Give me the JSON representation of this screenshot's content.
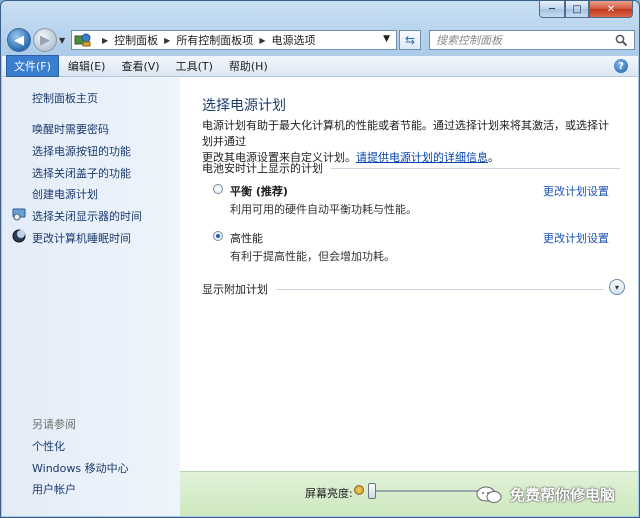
{
  "window": {
    "min_symbol": "─",
    "max_symbol": "□",
    "close_symbol": "✕"
  },
  "address": {
    "crumbs": [
      "控制面板",
      "所有控制面板项",
      "电源选项"
    ],
    "search_placeholder": "搜索控制面板"
  },
  "menu": {
    "items": [
      "文件(F)",
      "编辑(E)",
      "查看(V)",
      "工具(T)",
      "帮助(H)"
    ]
  },
  "sidebar": {
    "home": "控制面板主页",
    "links": [
      "唤醒时需要密码",
      "选择电源按钮的功能",
      "选择关闭盖子的功能",
      "创建电源计划",
      "选择关闭显示器的时间",
      "更改计算机睡眠时间"
    ],
    "see_also_title": "另请参阅",
    "see_also": [
      "个性化",
      "Windows 移动中心",
      "用户帐户"
    ]
  },
  "main": {
    "title": "选择电源计划",
    "desc_line1": "电源计划有助于最大化计算机的性能或者节能。通过选择计划来将其激活，或选择计划并通过",
    "desc_line2_prefix": "更改其电源设置来自定义计划。",
    "desc_link": "请提供电源计划的详细信息",
    "desc_end": "。",
    "group_label": "电池安时计上显示的计划",
    "plans": [
      {
        "name": "平衡 (推荐)",
        "desc": "利用可用的硬件自动平衡功耗与性能。",
        "change": "更改计划设置",
        "selected": false
      },
      {
        "name": "高性能",
        "desc": "有利于提高性能，但会增加功耗。",
        "change": "更改计划设置",
        "selected": true
      }
    ],
    "more_plans": "显示附加计划",
    "expander_symbol": "▾"
  },
  "bottom": {
    "brightness_label": "屏幕亮度:",
    "watermark": "免费帮你修电脑"
  }
}
